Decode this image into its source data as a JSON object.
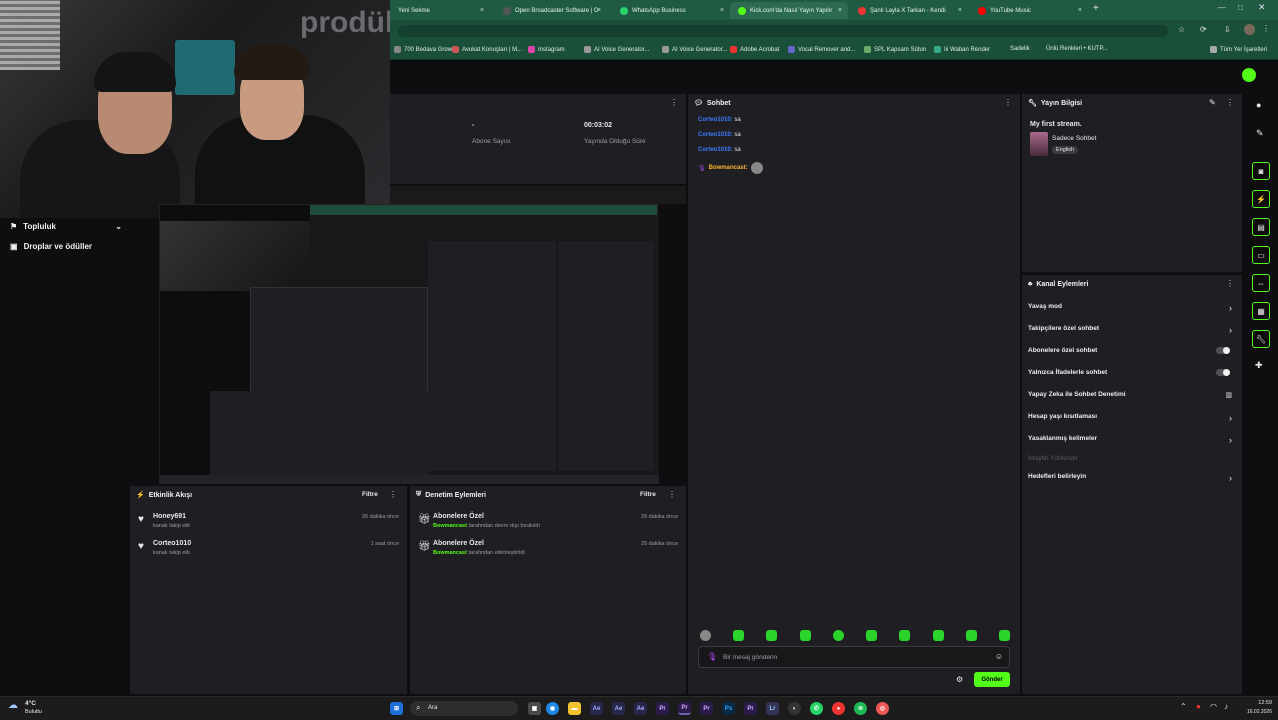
{
  "browser": {
    "tabs": [
      {
        "label": "Yeni Sekme",
        "color": "#4a7"
      },
      {
        "label": "Open Broadcaster Software | O",
        "color": "#555"
      },
      {
        "label": "WhatsApp Business",
        "color": "#25d366"
      },
      {
        "label": "Kick.com'da Nasıl Yayın Yapılır",
        "color": "#53fc18"
      },
      {
        "label": "Şanlı Layla X Tarkan - Kendi",
        "color": "#e33"
      },
      {
        "label": "YouTube Music",
        "color": "#f00"
      }
    ],
    "bookmarks": [
      "700 Bedava Grow...",
      "Avukat Konuşları | M...",
      "Instagram",
      "AI Voice Generator...",
      "AI Voice Generator...",
      "Adobe Acrobat",
      "Vocal Remover and...",
      "SPL Kapsam Sütun",
      "Iii Waban Render",
      "Sadelik",
      "Ünlü Renkleri • KUTP...",
      "Tüm Yer İşaretleri"
    ]
  },
  "sidebar": {
    "items": [
      {
        "label": "Topluluk"
      },
      {
        "label": "Droplar ve ödüller"
      }
    ]
  },
  "stats": {
    "followers_value": "-",
    "followers_label": "Abone Sayısı",
    "duration_value": "00:03:02",
    "duration_label": "Yayında Olduğu Süre"
  },
  "chat": {
    "title": "Sohbet",
    "messages": [
      {
        "user": "Corteo1010:",
        "text": "sa"
      },
      {
        "user": "Corteo1010:",
        "text": "sa"
      },
      {
        "user": "Corteo1010:",
        "text": "sa"
      },
      {
        "user": "Bowmancast:",
        "text": ""
      }
    ],
    "input_placeholder": "Bir mesaj gönderin",
    "send_label": "Gönder"
  },
  "stream_info": {
    "title": "Yayın Bilgisi",
    "stream_title": "My first stream.",
    "category": "Sadece Sohbet",
    "language": "English"
  },
  "channel_actions": {
    "title": "Kanal Eylemleri",
    "items": [
      {
        "label": "Yavaş mod",
        "control": "chevron"
      },
      {
        "label": "Takipçilere özel sohbet",
        "control": "chevron"
      },
      {
        "label": "Abonelere özel sohbet",
        "control": "toggle"
      },
      {
        "label": "Yalnızca İfadelerle sohbet",
        "control": "toggle"
      },
      {
        "label": "Yapay Zeka ile Sohbet Denetimi",
        "control": "icon"
      },
      {
        "label": "Hesap yaşı kısıtlaması",
        "control": "chevron"
      },
      {
        "label": "Yasaklanmış kelimeler",
        "control": "chevron"
      },
      {
        "label": "İstaytiri Yönlendir",
        "control": "none",
        "disabled": true
      },
      {
        "label": "Hedefleri belirleyin",
        "control": "chevron"
      }
    ]
  },
  "activity": {
    "title": "Etkinlik Akışı",
    "filter_label": "Filtre",
    "items": [
      {
        "user": "Honey691",
        "action": "kanalı takip etti",
        "time": "26 dakika önce"
      },
      {
        "user": "Corteo1010",
        "action": "kanalı takip etti",
        "time": "1 saat önce"
      }
    ]
  },
  "moderation": {
    "title": "Denetim Eylemleri",
    "filter_label": "Filtre",
    "items": [
      {
        "title": "Abonelere Özel",
        "actor": "Bowmancast",
        "desc": "tarafından devre dışı bırakıldı",
        "time": "29 dakika önce"
      },
      {
        "title": "Abonelere Özel",
        "actor": "Bowmancast",
        "desc": "tarafından etkinleştirildi",
        "time": "29 dakika önce"
      }
    ]
  },
  "taskbar": {
    "weather_temp": "4°C",
    "weather_text": "Bulutlu",
    "search_label": "Ara",
    "time": "12:59",
    "date": "16.02.2026"
  },
  "webcam_overlay_text": "prodük",
  "colors": {
    "accent": "#53fc18",
    "panel": "#1f1f23",
    "bg": "#0e0e10",
    "browser": "#1a4f3a"
  }
}
